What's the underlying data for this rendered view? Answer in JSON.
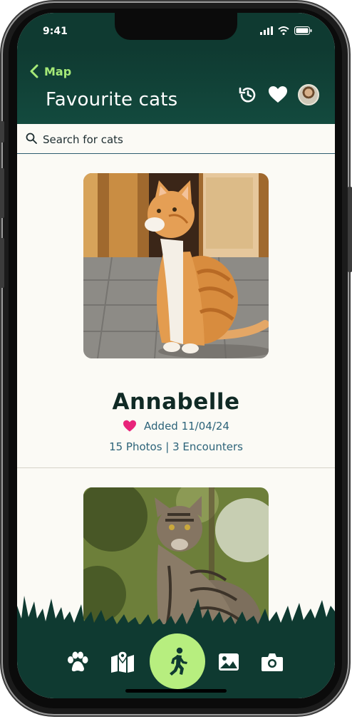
{
  "status": {
    "time": "9:41"
  },
  "header": {
    "back_label": "Map",
    "title": "Favourite cats"
  },
  "search": {
    "placeholder": "Search for cats"
  },
  "cats": [
    {
      "name": "Annabelle",
      "added": "Added 11/04/24",
      "stats": "15 Photos | 3 Encounters"
    }
  ],
  "colors": {
    "header_bg": "#0f3a31",
    "accent_green": "#a6ea78",
    "walk_button": "#b7ee7f",
    "heart_pink": "#e8247a",
    "info_text": "#2c6379",
    "background": "#fbfaf5"
  },
  "icons": {
    "header": [
      "history-icon",
      "heart-icon",
      "avatar"
    ],
    "nav": [
      "paw-icon",
      "map-icon",
      "walking-icon",
      "image-icon",
      "camera-icon"
    ]
  }
}
